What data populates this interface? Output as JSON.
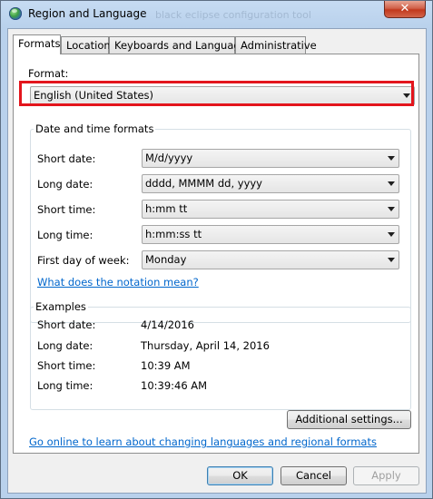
{
  "window": {
    "title": "Region and Language",
    "background_title": "black eclipse configuration tool",
    "close_glyph": "✕"
  },
  "tabs": [
    {
      "label": "Formats",
      "active": true
    },
    {
      "label": "Location",
      "active": false
    },
    {
      "label": "Keyboards and Languages",
      "active": false
    },
    {
      "label": "Administrative",
      "active": false
    }
  ],
  "format": {
    "label": "Format:",
    "value": "English (United States)"
  },
  "date_time_formats": {
    "title": "Date and time formats",
    "fields": [
      {
        "label": "Short date:",
        "value": "M/d/yyyy"
      },
      {
        "label": "Long date:",
        "value": "dddd, MMMM dd, yyyy"
      },
      {
        "label": "Short time:",
        "value": "h:mm tt"
      },
      {
        "label": "Long time:",
        "value": "h:mm:ss tt"
      },
      {
        "label": "First day of week:",
        "value": "Monday"
      }
    ],
    "notation_link": "What does the notation mean?"
  },
  "examples": {
    "title": "Examples",
    "rows": [
      {
        "label": "Short date:",
        "value": "4/14/2016"
      },
      {
        "label": "Long date:",
        "value": "Thursday, April 14, 2016"
      },
      {
        "label": "Short time:",
        "value": "10:39 AM"
      },
      {
        "label": "Long time:",
        "value": "10:39:46 AM"
      }
    ]
  },
  "additional_settings_label": "Additional settings...",
  "online_link": "Go online to learn about changing languages and regional formats",
  "buttons": {
    "ok": "OK",
    "cancel": "Cancel",
    "apply": "Apply"
  },
  "colors": {
    "highlight_border": "#e3151c",
    "link": "#0066cc"
  }
}
